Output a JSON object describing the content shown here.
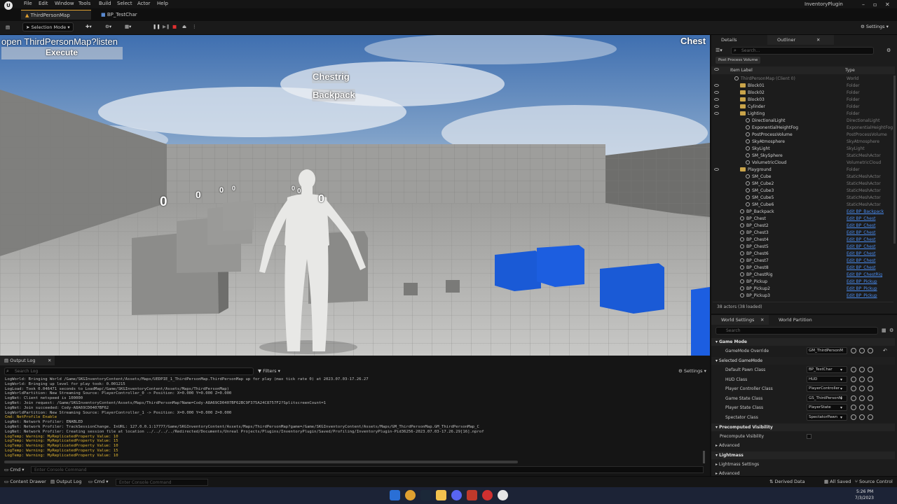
{
  "menu": {
    "items": [
      "File",
      "Edit",
      "Window",
      "Tools",
      "Build",
      "Select",
      "Actor",
      "Help"
    ],
    "project": "InventoryPlugin"
  },
  "tabs": [
    {
      "label": "ThirdPersonMap"
    },
    {
      "label": "BP_TestChar"
    }
  ],
  "toolbar": {
    "selection_mode": "Selection Mode",
    "settings": "Settings"
  },
  "viewport": {
    "console_cmd": "open ThirdPersonMap?listen",
    "execute": "Execute",
    "hud_label": "Chest",
    "item1": "Chestrig",
    "item2": "Backpack",
    "counters": [
      "0",
      "0",
      "0",
      "0",
      "0",
      "0",
      "0"
    ]
  },
  "details": {
    "tab_details": "Details",
    "tab_outliner": "Outliner",
    "search_placeholder": "Search...",
    "filter_chip": "Post Process Volume",
    "col_label": "Item Label",
    "col_type": "Type",
    "rows": [
      {
        "label": "ThirdPersonMap (Client 0)",
        "type": "World",
        "indent": 0,
        "kind": "world"
      },
      {
        "label": "Block01",
        "type": "Folder",
        "indent": 1,
        "kind": "folder"
      },
      {
        "label": "Block02",
        "type": "Folder",
        "indent": 1,
        "kind": "folder"
      },
      {
        "label": "Block03",
        "type": "Folder",
        "indent": 1,
        "kind": "folder"
      },
      {
        "label": "Cylinder",
        "type": "Folder",
        "indent": 1,
        "kind": "folder"
      },
      {
        "label": "Lighting",
        "type": "Folder",
        "indent": 1,
        "kind": "folder"
      },
      {
        "label": "DirectionalLight",
        "type": "DirectionalLight",
        "indent": 2,
        "kind": "actor"
      },
      {
        "label": "ExponentialHeightFog",
        "type": "ExponentialHeightFog",
        "indent": 2,
        "kind": "actor"
      },
      {
        "label": "PostProcessVolume",
        "type": "PostProcessVolume",
        "indent": 2,
        "kind": "actor"
      },
      {
        "label": "SkyAtmosphere",
        "type": "SkyAtmosphere",
        "indent": 2,
        "kind": "actor"
      },
      {
        "label": "SkyLight",
        "type": "SkyLight",
        "indent": 2,
        "kind": "actor"
      },
      {
        "label": "SM_SkySphere",
        "type": "StaticMeshActor",
        "indent": 2,
        "kind": "actor"
      },
      {
        "label": "VolumetricCloud",
        "type": "VolumetricCloud",
        "indent": 2,
        "kind": "actor"
      },
      {
        "label": "Playground",
        "type": "Folder",
        "indent": 1,
        "kind": "folder"
      },
      {
        "label": "SM_Cube",
        "type": "StaticMeshActor",
        "indent": 2,
        "kind": "actor"
      },
      {
        "label": "SM_Cube2",
        "type": "StaticMeshActor",
        "indent": 2,
        "kind": "actor"
      },
      {
        "label": "SM_Cube3",
        "type": "StaticMeshActor",
        "indent": 2,
        "kind": "actor"
      },
      {
        "label": "SM_Cube5",
        "type": "StaticMeshActor",
        "indent": 2,
        "kind": "actor"
      },
      {
        "label": "SM_Cube6",
        "type": "StaticMeshActor",
        "indent": 2,
        "kind": "actor"
      },
      {
        "label": "BP_Backpack",
        "type": "Edit BP_Backpack",
        "indent": 1,
        "kind": "bp"
      },
      {
        "label": "BP_Chest",
        "type": "Edit BP_Chest",
        "indent": 1,
        "kind": "bp"
      },
      {
        "label": "BP_Chest2",
        "type": "Edit BP_Chest",
        "indent": 1,
        "kind": "bp"
      },
      {
        "label": "BP_Chest3",
        "type": "Edit BP_Chest",
        "indent": 1,
        "kind": "bp"
      },
      {
        "label": "BP_Chest4",
        "type": "Edit BP_Chest",
        "indent": 1,
        "kind": "bp"
      },
      {
        "label": "BP_Chest5",
        "type": "Edit BP_Chest",
        "indent": 1,
        "kind": "bp"
      },
      {
        "label": "BP_Chest6",
        "type": "Edit BP_Chest",
        "indent": 1,
        "kind": "bp"
      },
      {
        "label": "BP_Chest7",
        "type": "Edit BP_Chest",
        "indent": 1,
        "kind": "bp"
      },
      {
        "label": "BP_Chest8",
        "type": "Edit BP_Chest",
        "indent": 1,
        "kind": "bp"
      },
      {
        "label": "BP_ChestRig",
        "type": "Edit BP_ChestRig",
        "indent": 1,
        "kind": "bp"
      },
      {
        "label": "BP_Pickup",
        "type": "Edit BP_Pickup",
        "indent": 1,
        "kind": "bp"
      },
      {
        "label": "BP_Pickup2",
        "type": "Edit BP_Pickup",
        "indent": 1,
        "kind": "bp"
      },
      {
        "label": "BP_Pickup3",
        "type": "Edit BP_Pickup",
        "indent": 1,
        "kind": "bp"
      }
    ],
    "actor_count": "38 actors (38 loaded)"
  },
  "world_settings": {
    "tab1": "World Settings",
    "tab2": "World Partition",
    "search_placeholder": "Search",
    "sections": {
      "game_mode": "Game Mode",
      "selected_game_mode": "Selected GameMode",
      "precomputed_visibility": "Precomputed Visibility",
      "lightmass": "Lightmass"
    },
    "props": [
      {
        "label": "GameMode Override",
        "value": "GM_ThirdPersonM"
      },
      {
        "label": "Default Pawn Class",
        "value": "BP_TestChar"
      },
      {
        "label": "HUD Class",
        "value": "HUD"
      },
      {
        "label": "Player Controller Class",
        "value": "PlayerController"
      },
      {
        "label": "Game State Class",
        "value": "GS_ThirdPersonM"
      },
      {
        "label": "Player State Class",
        "value": "PlayerState"
      },
      {
        "label": "Spectator Class",
        "value": "SpectatorPawn"
      }
    ],
    "precompute_label": "Precompute Visibility",
    "advanced": "Advanced",
    "lightmass_settings": "Lightmass Settings",
    "advanced2": "Advanced"
  },
  "output_log": {
    "tab": "Output Log",
    "search_placeholder": "Search Log",
    "filters": "Filters",
    "settings": "Settings",
    "lines": [
      {
        "text": "LogWorld: Bringing World /Game/SKGInventoryContent/Assets/Maps/UEDPIE_1_ThirdPersonMap.ThirdPersonMap up for play (max tick rate 0) at 2023.07.03-17.26.27",
        "warn": false
      },
      {
        "text": "LogWorld: Bringing up level for play took: 0.001215",
        "warn": false
      },
      {
        "text": "LogLoad: Took 0.046471 seconds to LoadMap(/Game/SKGInventoryContent/Assets/Maps/ThirdPersonMap)",
        "warn": false
      },
      {
        "text": "LogWorldPartition: New Streaming Source: PlayerController_0 -> Position: X=0.000 Y=0.000 Z=0.000",
        "warn": false
      },
      {
        "text": "LogNet: Client netspeed is 100000",
        "warn": false
      },
      {
        "text": "LogNet: Join request: /Game/SKGInventoryContent/Assets/Maps/ThirdPersonMap?Name=Cody-A8A69CD0407BF62BC9F375A24C8757F2?SplitscreenCount=1",
        "warn": false
      },
      {
        "text": "LogNet: Join succeeded: Cody-A8A69CD0407BF62",
        "warn": false
      },
      {
        "text": "LogWorldPartition: New Streaming Source: PlayerController_1 -> Position: X=0.000 Y=0.000 Z=0.000",
        "warn": false
      },
      {
        "text": "Cmd: NetProfile Enable",
        "warn": true
      },
      {
        "text": "LogNet: Network Profiler: ENABLED",
        "warn": false
      },
      {
        "text": "LogNet: Network Profiler: TrackSessionChange.  InURL: 127.0.0.1:17777/Game/SKGInventoryContent/Assets/Maps/ThirdPersonMap?game=/Game/SKGInventoryContent/Assets/Maps/GM_ThirdPersonMap.GM_ThirdPersonMap_C",
        "warn": false
      },
      {
        "text": "LogNet: Network Profiler: Creating session file at location ../../../../Redirected/Documents/Unreal Projects/Plugins/InventoryPlugin/Saved/Profiling/InventoryPlugin-Pid36256-2023.07.03-17.26.29[16].nprof",
        "warn": false
      },
      {
        "text": "LogTemp: Warning: MyReplicatedProperty Value: 10",
        "warn": true
      },
      {
        "text": "LogTemp: Warning: MyReplicatedProperty Value: 15",
        "warn": true
      },
      {
        "text": "LogTemp: Warning: MyReplicatedProperty Value: 10",
        "warn": true
      },
      {
        "text": "LogTemp: Warning: MyReplicatedProperty Value: 15",
        "warn": true
      },
      {
        "text": "LogTemp: Warning: MyReplicatedProperty Value: 10",
        "warn": true
      }
    ],
    "cmd": "Cmd",
    "console_placeholder": "Enter Console Command"
  },
  "statusbar": {
    "content_drawer": "Content Drawer",
    "output_log": "Output Log",
    "cmd": "Cmd",
    "console_placeholder": "Enter Console Command",
    "derived_data": "Derived Data",
    "all_saved": "All Saved",
    "source_control": "Source Control"
  },
  "taskbar": {
    "time": "5:26 PM",
    "date": "7/3/2023"
  }
}
